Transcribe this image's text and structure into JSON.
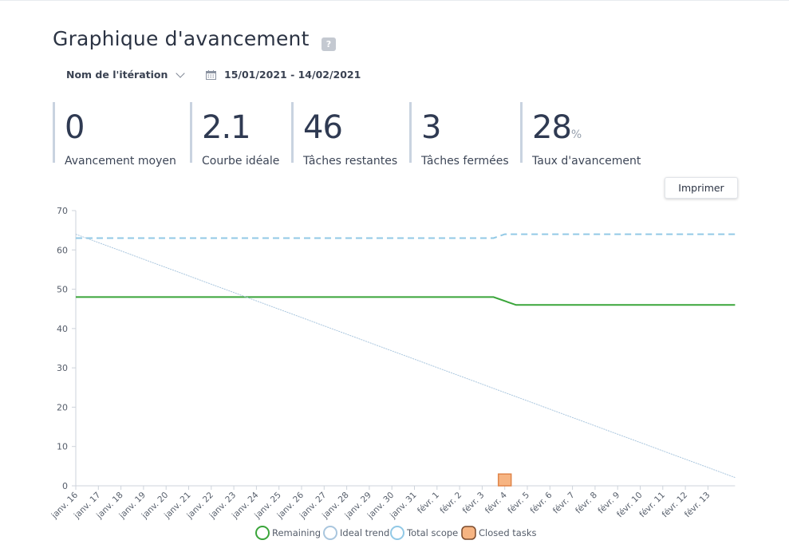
{
  "page": {
    "title": "Graphique d'avancement",
    "help_icon": "?",
    "iteration_select": "Nom de l'itération",
    "date_range": "15/01/2021 - 14/02/2021",
    "print_button": "Imprimer"
  },
  "stats": [
    {
      "value": "0",
      "unit": "",
      "label": "Avancement moyen"
    },
    {
      "value": "2.1",
      "unit": "",
      "label": "Courbe idéale"
    },
    {
      "value": "46",
      "unit": "",
      "label": "Tâches restantes"
    },
    {
      "value": "3",
      "unit": "",
      "label": "Tâches fermées"
    },
    {
      "value": "28",
      "unit": "%",
      "label": "Taux d'avancement"
    }
  ],
  "colors": {
    "remaining": "#3aa53a",
    "ideal": "#a9c6de",
    "scope": "#92c9e6",
    "closed_fill": "#f6b482",
    "closed_stroke": "#e0854a"
  },
  "chart_data": {
    "type": "line",
    "ylim": [
      0,
      70
    ],
    "yticks": [
      0,
      10,
      20,
      30,
      40,
      50,
      60,
      70
    ],
    "categories": [
      "janv. 16",
      "janv. 17",
      "janv. 18",
      "janv. 19",
      "janv. 20",
      "janv. 21",
      "janv. 22",
      "janv. 23",
      "janv. 24",
      "janv. 25",
      "janv. 26",
      "janv. 27",
      "janv. 28",
      "janv. 29",
      "janv. 30",
      "janv. 31",
      "févr. 1",
      "févr. 2",
      "févr. 3",
      "févr. 4",
      "févr. 5",
      "févr. 6",
      "févr. 7",
      "févr. 8",
      "févr. 9",
      "févr. 10",
      "févr. 11",
      "févr. 12",
      "févr. 13"
    ],
    "x_extent": [
      0,
      29.2
    ],
    "grid": false,
    "legend_position": "bottom",
    "series": [
      {
        "name": "Remaining",
        "kind": "line",
        "style": "solid",
        "color": "#3aa53a",
        "points": [
          [
            0,
            48
          ],
          [
            18.5,
            48
          ],
          [
            19.5,
            46
          ],
          [
            29.2,
            46
          ]
        ]
      },
      {
        "name": "Ideal trend",
        "kind": "line",
        "style": "thin",
        "color": "#a9c6de",
        "points": [
          [
            0,
            64
          ],
          [
            29.2,
            2.1
          ]
        ]
      },
      {
        "name": "Total scope",
        "kind": "line",
        "style": "dashed",
        "color": "#92c9e6",
        "points": [
          [
            0,
            63
          ],
          [
            18.5,
            63
          ],
          [
            19,
            64
          ],
          [
            29.2,
            64
          ]
        ]
      },
      {
        "name": "Closed tasks",
        "kind": "bar",
        "color": "#f6b482",
        "points": [
          [
            19,
            3
          ]
        ]
      }
    ]
  }
}
